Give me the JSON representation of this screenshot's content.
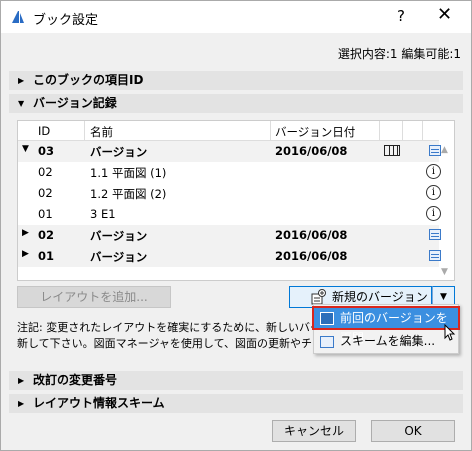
{
  "window": {
    "title": "ブック設定",
    "help": "?",
    "close": "✕"
  },
  "selection_info": "選択内容:1 編集可能:1",
  "sections": {
    "item_id": "このブックの項目ID",
    "versions": "バージョン記録",
    "revision": "改訂の変更番号",
    "layout_scheme": "レイアウト情報スキーム"
  },
  "table": {
    "headers": {
      "id": "ID",
      "name": "名前",
      "date": "バージョン日付"
    },
    "rows": [
      {
        "kind": "group",
        "expanded": true,
        "id": "03",
        "name": "バージョン",
        "date": "2016/06/08",
        "icons": [
          "layout-icon",
          "document-icon"
        ]
      },
      {
        "kind": "item",
        "id": "02",
        "name": "1.1 平面図 (1)",
        "date": "",
        "icons": [
          "info-icon"
        ]
      },
      {
        "kind": "item",
        "id": "02",
        "name": "1.2 平面図 (2)",
        "date": "",
        "icons": [
          "info-icon"
        ]
      },
      {
        "kind": "item",
        "id": "01",
        "name": "3 E1",
        "date": "",
        "icons": [
          "info-icon"
        ]
      },
      {
        "kind": "group",
        "expanded": false,
        "id": "02",
        "name": "バージョン",
        "date": "2016/06/08",
        "icons": [
          "document-icon"
        ]
      },
      {
        "kind": "group",
        "expanded": false,
        "id": "01",
        "name": "バージョン",
        "date": "2016/06/08",
        "icons": [
          "document-icon"
        ]
      }
    ]
  },
  "buttons": {
    "add_layout": "レイアウトを追加...",
    "new_version": "新規のバージョン",
    "cancel": "キャンセル",
    "ok": "OK"
  },
  "note": {
    "line1": "注記: 変更されたレイアウトを確実にするために、新しいバージョンを作",
    "line2": "新して下さい。図面マネージャを使用して、図面の更新やチェックを行い"
  },
  "dropdown_menu": [
    {
      "label": "前回のバージョンを再開",
      "highlighted": true
    },
    {
      "label": "スキームを編集...",
      "highlighted": false
    }
  ],
  "colors": {
    "highlight": "#3b8fe0",
    "highlight_border": "#d9261c",
    "accent": "#0078d7"
  }
}
